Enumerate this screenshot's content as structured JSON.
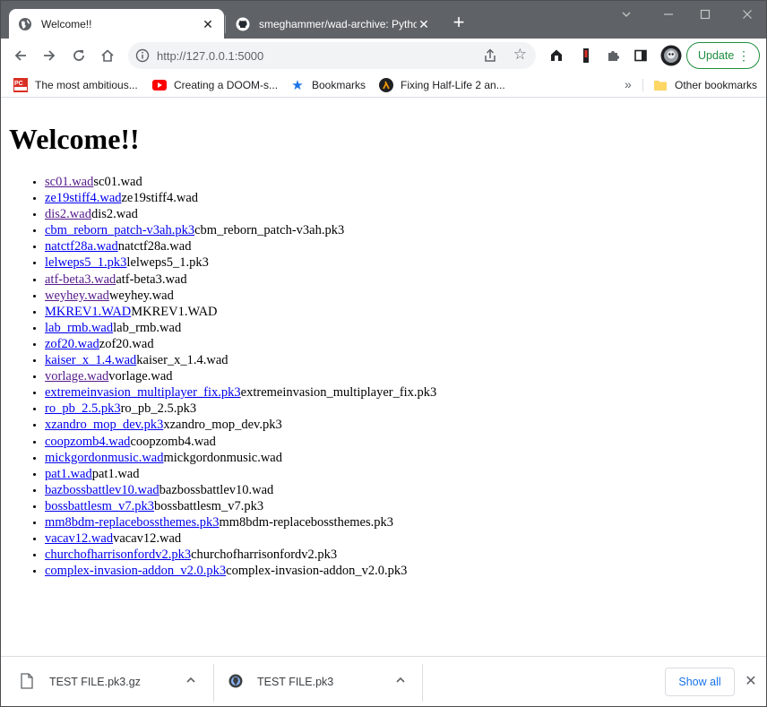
{
  "tabs": [
    {
      "title": "Welcome!!",
      "close": "✕"
    },
    {
      "title": "smeghammer/wad-archive: Pytho",
      "close": "✕"
    }
  ],
  "new_tab": "+",
  "window_controls": {
    "minimize": "—",
    "maximize": "☐",
    "close": "✕"
  },
  "toolbar": {
    "url": "http://127.0.0.1:5000",
    "update_label": "Update",
    "menu_dots": "⋮"
  },
  "bookmarks": [
    {
      "label": "The most ambitious...",
      "icon": "pcgamer-icon"
    },
    {
      "label": "Creating a DOOM-s...",
      "icon": "youtube-icon"
    },
    {
      "label": "Bookmarks",
      "icon": "star-icon"
    },
    {
      "label": "Fixing Half-Life 2 an...",
      "icon": "lambda-icon"
    }
  ],
  "bookmarks_more": "»",
  "other_bookmarks": "Other bookmarks",
  "page": {
    "heading": "Welcome!!",
    "items": [
      {
        "link": "sc01.wad",
        "text": "sc01.wad",
        "visited": true
      },
      {
        "link": "ze19stiff4.wad",
        "text": "ze19stiff4.wad",
        "visited": false
      },
      {
        "link": "dis2.wad",
        "text": "dis2.wad",
        "visited": true
      },
      {
        "link": "cbm_reborn_patch-v3ah.pk3",
        "text": "cbm_reborn_patch-v3ah.pk3",
        "visited": false
      },
      {
        "link": "natctf28a.wad",
        "text": "natctf28a.wad",
        "visited": false
      },
      {
        "link": "lelweps5_1.pk3",
        "text": "lelweps5_1.pk3",
        "visited": false
      },
      {
        "link": "atf-beta3.wad",
        "text": "atf-beta3.wad",
        "visited": true
      },
      {
        "link": "weyhey.wad",
        "text": "weyhey.wad",
        "visited": true
      },
      {
        "link": "MKREV1.WAD",
        "text": "MKREV1.WAD",
        "visited": false
      },
      {
        "link": "lab_rmb.wad",
        "text": "lab_rmb.wad",
        "visited": false
      },
      {
        "link": "zof20.wad",
        "text": "zof20.wad",
        "visited": false
      },
      {
        "link": "kaiser_x_1.4.wad",
        "text": "kaiser_x_1.4.wad",
        "visited": false
      },
      {
        "link": "vorlage.wad",
        "text": "vorlage.wad",
        "visited": true
      },
      {
        "link": "extremeinvasion_multiplayer_fix.pk3",
        "text": "extremeinvasion_multiplayer_fix.pk3",
        "visited": false
      },
      {
        "link": "ro_pb_2.5.pk3",
        "text": "ro_pb_2.5.pk3",
        "visited": false
      },
      {
        "link": "xzandro_mop_dev.pk3",
        "text": "xzandro_mop_dev.pk3",
        "visited": false
      },
      {
        "link": "coopzomb4.wad",
        "text": "coopzomb4.wad",
        "visited": false
      },
      {
        "link": "mickgordonmusic.wad",
        "text": "mickgordonmusic.wad",
        "visited": false
      },
      {
        "link": "pat1.wad",
        "text": "pat1.wad",
        "visited": false
      },
      {
        "link": "bazbossbattlev10.wad",
        "text": "bazbossbattlev10.wad",
        "visited": false
      },
      {
        "link": "bossbattlesm_v7.pk3",
        "text": "bossbattlesm_v7.pk3",
        "visited": false
      },
      {
        "link": "mm8bdm-replacebossthemes.pk3",
        "text": "mm8bdm-replacebossthemes.pk3",
        "visited": false
      },
      {
        "link": "vacav12.wad",
        "text": "vacav12.wad",
        "visited": false
      },
      {
        "link": "churchofharrisonfordv2.pk3",
        "text": "churchofharrisonfordv2.pk3",
        "visited": false
      },
      {
        "link": "complex-invasion-addon_v2.0.pk3",
        "text": "complex-invasion-addon_v2.0.pk3",
        "visited": false
      }
    ]
  },
  "downloads": [
    {
      "name": "TEST FILE.pk3.gz",
      "icon": "file-icon"
    },
    {
      "name": "TEST FILE.pk3",
      "icon": "doom-file-icon"
    }
  ],
  "show_all_label": "Show all",
  "shelf_close": "✕",
  "colors": {
    "link": "#0000ee",
    "visited": "#551a8b",
    "update_green": "#1e8e3e",
    "accent_blue": "#1a73e8"
  }
}
